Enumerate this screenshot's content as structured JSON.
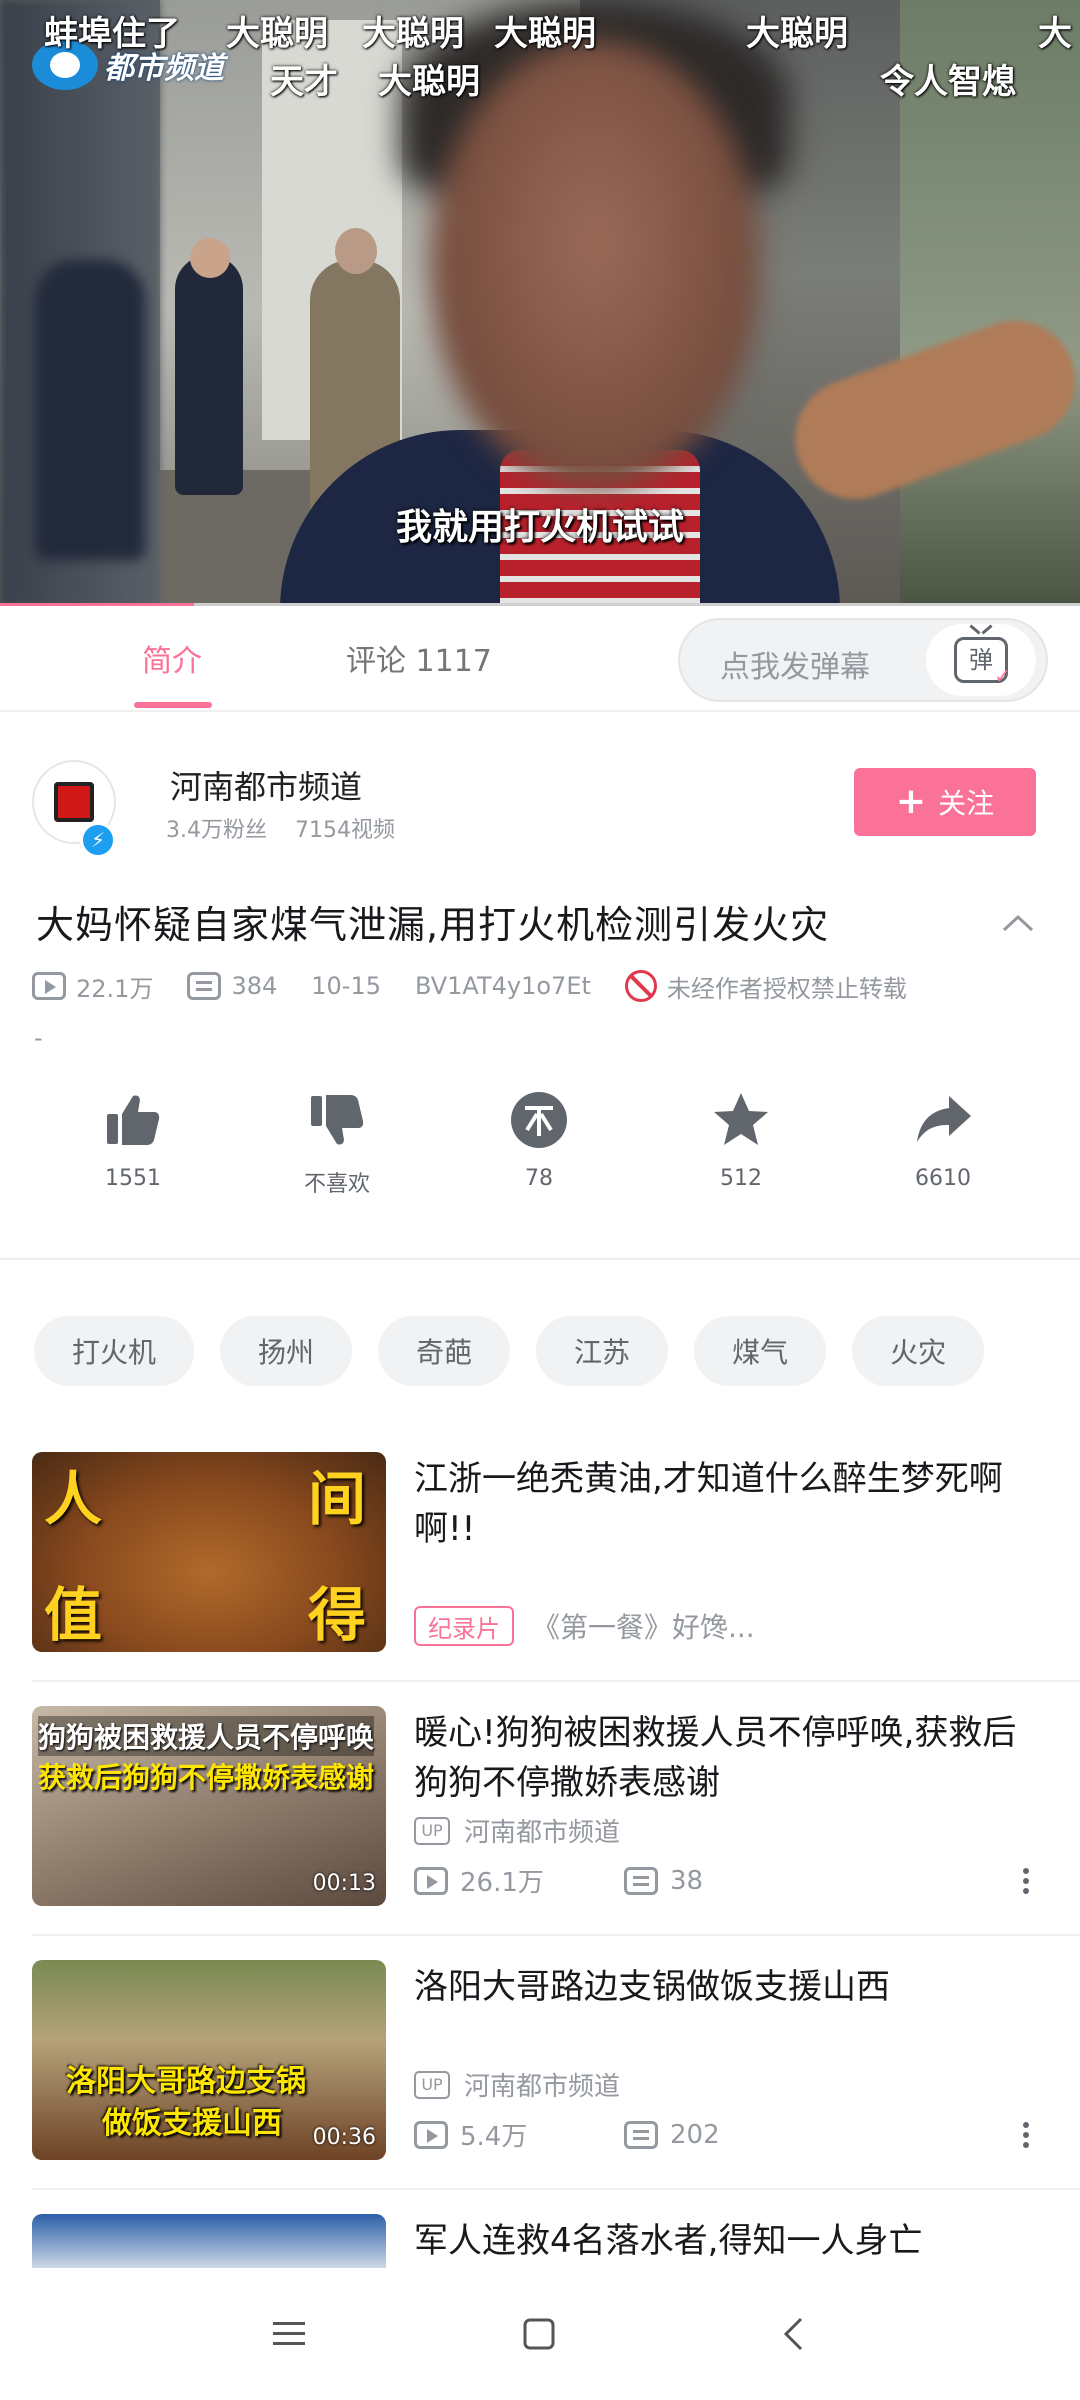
{
  "player": {
    "logo_text": "都市频道",
    "subtitle": "我就用打火机试试",
    "progress_fraction": 0.18,
    "danmaku": [
      "蚌埠住了",
      "大聪明",
      "大聪明",
      "大聪明",
      "大聪明",
      "大",
      "天才",
      "大聪明",
      "令人智熄"
    ]
  },
  "tabs": {
    "intro": "简介",
    "comments": "评论 1117",
    "danmu_placeholder": "点我发弹幕",
    "danmu_icon_glyph": "弹"
  },
  "uploader": {
    "name": "河南都市频道",
    "fans": "3.4万粉丝",
    "videos": "7154视频",
    "follow_label": "关注",
    "follow_icon": "+"
  },
  "video": {
    "title": "大妈怀疑自家煤气泄漏,用打火机检测引发火灾",
    "views": "22.1万",
    "danmaku_count": "384",
    "date": "10-15",
    "bvid": "BV1AT4y1o7Et",
    "copyright": "未经作者授权禁止转载",
    "desc": "-"
  },
  "actions": {
    "like": "1551",
    "dislike": "不喜欢",
    "coin": "78",
    "favorite": "512",
    "share": "6610"
  },
  "tags": [
    "打火机",
    "扬州",
    "奇葩",
    "江苏",
    "煤气",
    "火灾"
  ],
  "recommendations": [
    {
      "title": "江浙一绝秃黄油,才知道什么醉生梦死啊啊!!",
      "badge": "纪录片",
      "sub": "《第一餐》好馋...",
      "thumb_text": [
        "人",
        "间",
        "值",
        "得"
      ]
    },
    {
      "title": "暖心!狗狗被困救援人员不停呼唤,获救后狗狗不停撒娇表感谢",
      "up_badge": "UP",
      "up": "河南都市频道",
      "views": "26.1万",
      "danmaku": "38",
      "duration": "00:13",
      "thumb_text": [
        "狗狗被困救援人员不停呼唤",
        "获救后狗狗不停撒娇表感谢"
      ]
    },
    {
      "title": "洛阳大哥路边支锅做饭支援山西",
      "up_badge": "UP",
      "up": "河南都市频道",
      "views": "5.4万",
      "danmaku": "202",
      "duration": "00:36",
      "thumb_text": [
        "洛阳大哥路边支锅",
        "做饭支援山西"
      ]
    },
    {
      "title": "军人连救4名落水者,得知一人身亡"
    }
  ],
  "colors": {
    "accent": "#fb7299",
    "text": "#18191c",
    "muted": "#9499a0"
  },
  "icons": [
    "menu-icon",
    "home-square-icon",
    "back-icon",
    "like-icon",
    "dislike-icon",
    "coin-icon",
    "star-icon",
    "share-icon",
    "play-count-icon",
    "danmaku-count-icon",
    "no-repost-icon",
    "chevron-up-icon",
    "more-vertical-icon"
  ]
}
